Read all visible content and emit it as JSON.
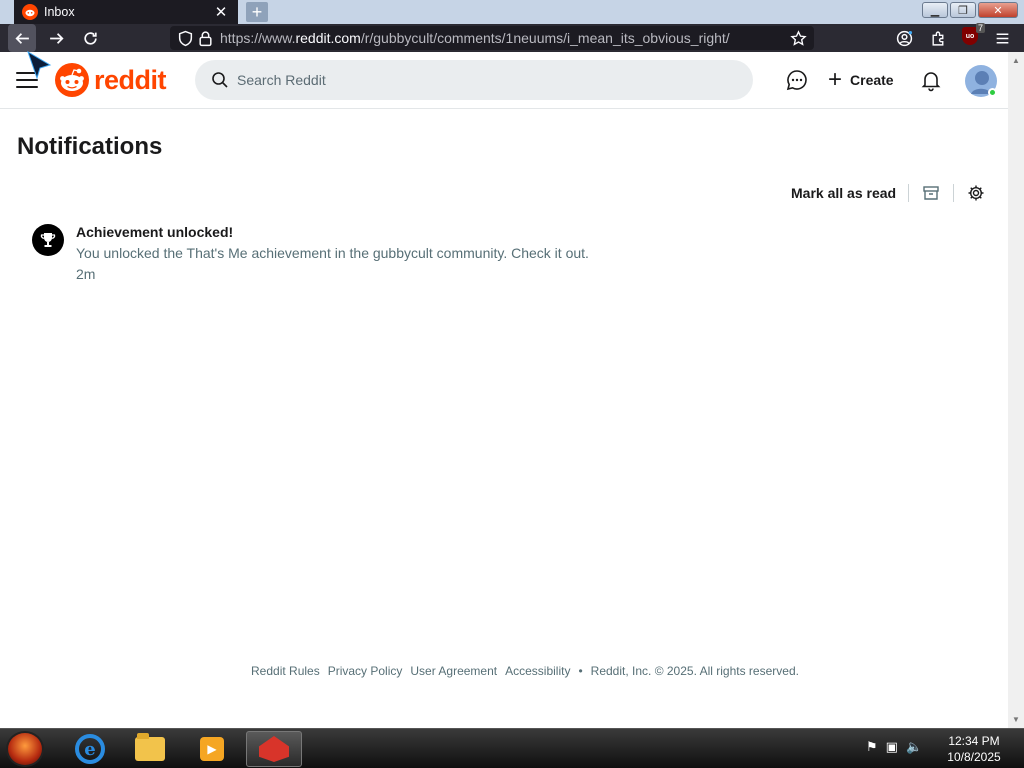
{
  "browser": {
    "tab_title": "Inbox",
    "url_prefix": "https://www.",
    "url_domain": "reddit.com",
    "url_path": "/r/gubbycult/comments/1neuums/i_mean_its_obvious_right/",
    "extension_badge": "7",
    "extension_label": "uo"
  },
  "header": {
    "logo_text": "reddit",
    "search_placeholder": "Search Reddit",
    "create_label": "Create"
  },
  "page": {
    "title": "Notifications",
    "mark_all_read": "Mark all as read"
  },
  "notifications": [
    {
      "title": "Achievement unlocked!",
      "body": "You unlocked the That's Me achievement in the gubbycult community. Check it out.",
      "time": "2m"
    }
  ],
  "footer": {
    "links": [
      "Reddit Rules",
      "Privacy Policy",
      "User Agreement",
      "Accessibility"
    ],
    "bullet": "•",
    "copyright": "Reddit, Inc. © 2025. All rights reserved."
  },
  "taskbar": {
    "time": "12:34 PM",
    "date": "10/8/2025"
  },
  "colors": {
    "brand": "#ff4500",
    "chrome_dark": "#2b2a33",
    "muted_text": "#576f76"
  }
}
